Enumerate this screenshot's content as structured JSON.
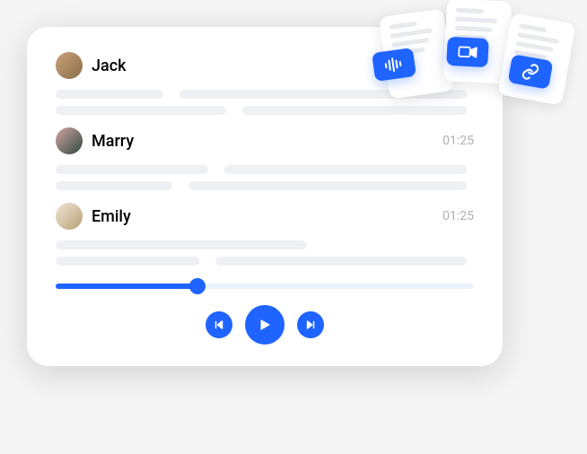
{
  "entries": [
    {
      "name": "Jack",
      "timestamp": null
    },
    {
      "name": "Marry",
      "timestamp": "01:25"
    },
    {
      "name": "Emily",
      "timestamp": "01:25"
    }
  ],
  "player": {
    "progress_percent": 34
  },
  "colors": {
    "accent": "#1f64ff",
    "placeholder": "#eef0f3",
    "track_bg": "#eaf2ff"
  },
  "attachments": [
    {
      "type": "audio"
    },
    {
      "type": "video"
    },
    {
      "type": "link"
    }
  ]
}
